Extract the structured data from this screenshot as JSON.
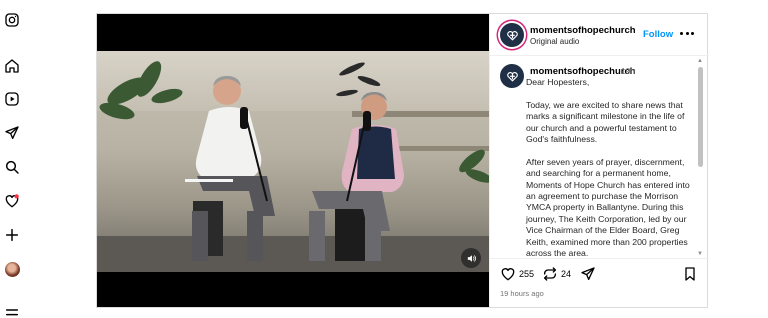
{
  "nav": {
    "items": [
      {
        "name": "instagram-icon"
      },
      {
        "name": "home-icon"
      },
      {
        "name": "reels-icon"
      },
      {
        "name": "messages-icon"
      },
      {
        "name": "search-icon"
      },
      {
        "name": "notifications-icon"
      },
      {
        "name": "create-icon"
      },
      {
        "name": "profile-avatar"
      },
      {
        "name": "menu-icon"
      }
    ],
    "notification_dot_color": "#ff3040"
  },
  "post": {
    "author": "momentsofhopechurch",
    "audio": "Original audio",
    "follow_label": "Follow",
    "caption": {
      "author": "momentsofhopechurch",
      "age": "19h",
      "paragraphs": [
        "Dear Hopesters,",
        "Today, we are excited to share news that marks a significant milestone in the life of our church and a powerful testament to God's faithfulness.",
        "After seven years of prayer, discernment, and searching for a permanent home, Moments of Hope Church has entered into an agreement to purchase the Morrison YMCA property in Ballantyne. During this journey, The Keith Corporation, led by our Vice Chairman of the Elder Board, Greg Keith, examined more than 200 properties across the area."
      ]
    },
    "likes": "255",
    "reposts": "24",
    "timestamp": "19 hours ago"
  },
  "colors": {
    "accent": "#0095f6",
    "brand_navy": "#1f2f45",
    "story_ring": "#d3277a",
    "muted_text": "#737373"
  }
}
